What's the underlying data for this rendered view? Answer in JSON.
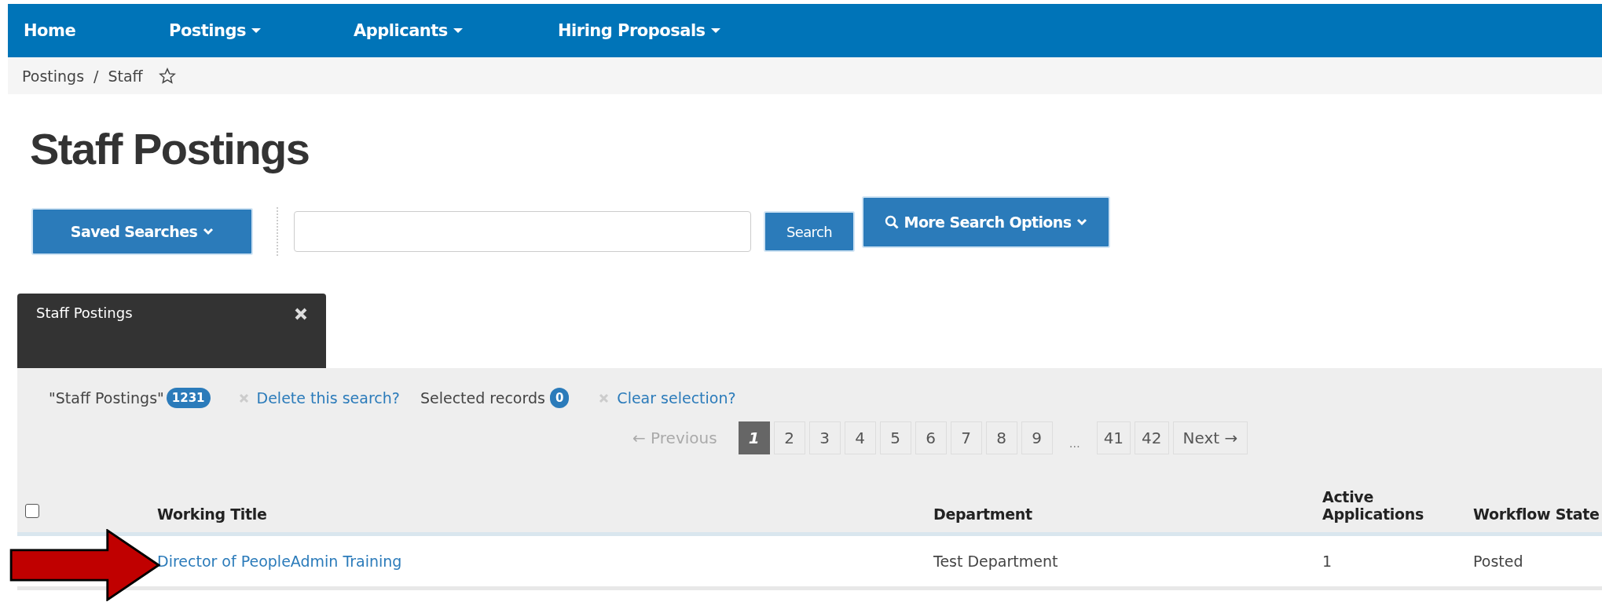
{
  "nav": [
    {
      "label": "Home",
      "dropdown": false
    },
    {
      "label": "Postings",
      "dropdown": true
    },
    {
      "label": "Applicants",
      "dropdown": true
    },
    {
      "label": "Hiring Proposals",
      "dropdown": true
    }
  ],
  "breadcrumb": {
    "items": [
      "Postings",
      "Staff"
    ],
    "separator": "/",
    "favorite": false
  },
  "title": "Staff Postings",
  "search": {
    "saved_searches": "Saved Searches",
    "search_button": "Search",
    "more_options": "More Search Options"
  },
  "search_tab": {
    "label": "Staff Postings"
  },
  "summary": {
    "search_name": "\"Staff Postings\"",
    "count": "1231",
    "delete_link": "Delete this search?",
    "selected_label": "Selected records",
    "selected_count": "0",
    "clear_link": "Clear selection?"
  },
  "pagination": {
    "previous": "← Previous",
    "previous_disabled": true,
    "next": "Next →",
    "pages": [
      {
        "kind": "page",
        "label": "1",
        "selected": true
      },
      {
        "kind": "page",
        "label": "2",
        "selected": false
      },
      {
        "kind": "page",
        "label": "3",
        "selected": false
      },
      {
        "kind": "page",
        "label": "4",
        "selected": false
      },
      {
        "kind": "page",
        "label": "5",
        "selected": false
      },
      {
        "kind": "page",
        "label": "6",
        "selected": false
      },
      {
        "kind": "page",
        "label": "7",
        "selected": false
      },
      {
        "kind": "page",
        "label": "8",
        "selected": false
      },
      {
        "kind": "page",
        "label": "9",
        "selected": false
      },
      {
        "kind": "gap",
        "label": "…"
      },
      {
        "kind": "page",
        "label": "41",
        "selected": false
      },
      {
        "kind": "page",
        "label": "42",
        "selected": false
      }
    ]
  },
  "table": {
    "select_all_checked": false,
    "columns": [
      "Working Title",
      "Department",
      "Active Applications",
      "Workflow State"
    ],
    "rows": [
      {
        "cells": [
          "Director of PeopleAdmin Training",
          "Test Department",
          "1",
          "Posted"
        ]
      }
    ]
  }
}
